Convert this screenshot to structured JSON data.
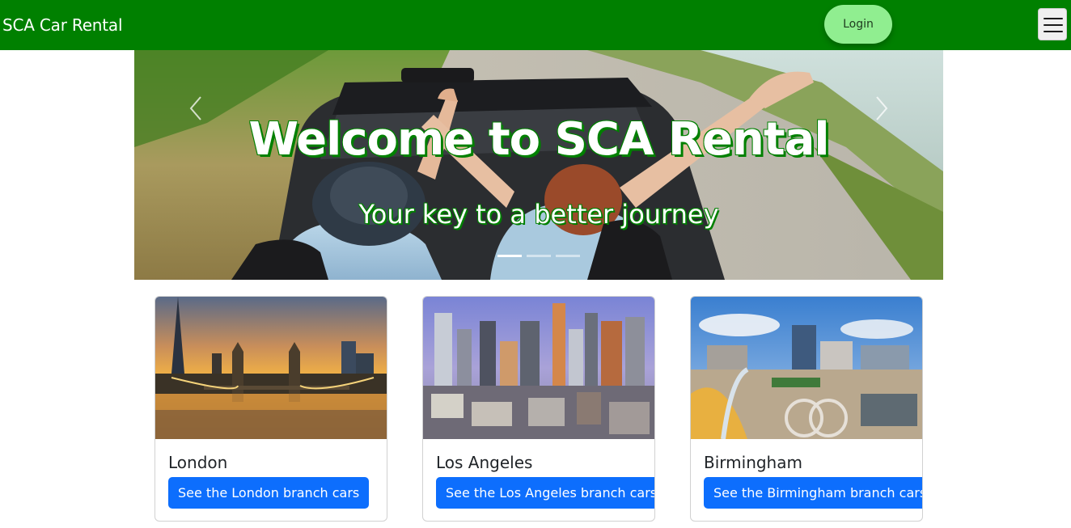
{
  "navbar": {
    "brand": "SCA Car Rental",
    "login_label": "Login",
    "background_color": "#008000",
    "login_color": "#90ee90"
  },
  "carousel": {
    "title": "Welcome to SCA Rental",
    "subtitle": "Your key to a better journey",
    "slide_count": 3,
    "active_slide": 1,
    "prev_icon": "chevron-left-icon",
    "next_icon": "chevron-right-icon"
  },
  "branches": [
    {
      "name": "London",
      "button": "See the London branch cars"
    },
    {
      "name": "Los Angeles",
      "button": "See the Los Angeles branch cars"
    },
    {
      "name": "Birmingham",
      "button": "See the Birmingham branch cars"
    }
  ],
  "colors": {
    "accent": "#008000",
    "button_primary": "#0d6efd"
  }
}
